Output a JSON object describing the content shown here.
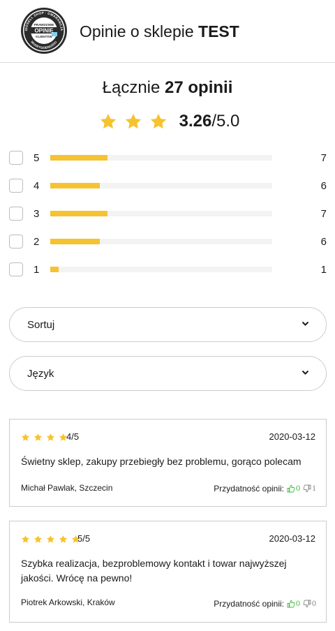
{
  "header": {
    "logo": {
      "top_text": "IDOSELL SHOP · GWARANCJA",
      "prawdziwe": "PRAWDZIWE",
      "opinie": "OPINIE",
      "klientow": "KLIENTÓW",
      "bottom_text": "WIARYGODNOŚCI"
    },
    "title_prefix": "Opinie o sklepie ",
    "title_shop": "TEST"
  },
  "summary": {
    "total_prefix": "Łącznie ",
    "total_count": "27 opinii",
    "average": "3.26",
    "scale": "/5.0",
    "average_stars": 3
  },
  "colors": {
    "accent": "#f5c330",
    "track": "#f3f3f3",
    "thumb_up": "#3dbb3d",
    "thumb_down": "#888888"
  },
  "breakdown": [
    {
      "label": "5",
      "count": "7",
      "fraction": 0.259
    },
    {
      "label": "4",
      "count": "6",
      "fraction": 0.222
    },
    {
      "label": "3",
      "count": "7",
      "fraction": 0.259
    },
    {
      "label": "2",
      "count": "6",
      "fraction": 0.222
    },
    {
      "label": "1",
      "count": "1",
      "fraction": 0.037
    }
  ],
  "filters": {
    "sort_label": "Sortuj",
    "language_label": "Język",
    "chevron_icon": "chevron-down-icon"
  },
  "reviews": [
    {
      "stars": 4,
      "score": "4/5",
      "date": "2020-03-12",
      "text": "Świetny sklep, zakupy przebiegły bez problemu, gorąco polecam",
      "author": "Michał Pawlak, Szczecin",
      "useful_label": "Przydatność opinii:",
      "up": "0",
      "down": "1"
    },
    {
      "stars": 5,
      "score": "5/5",
      "date": "2020-03-12",
      "text": "Szybka realizacja, bezproblemowy kontakt i towar najwyższej jakości. Wrócę na pewno!",
      "author": "Piotrek Arkowski, Kraków",
      "useful_label": "Przydatność opinii:",
      "up": "0",
      "down": "0"
    }
  ]
}
